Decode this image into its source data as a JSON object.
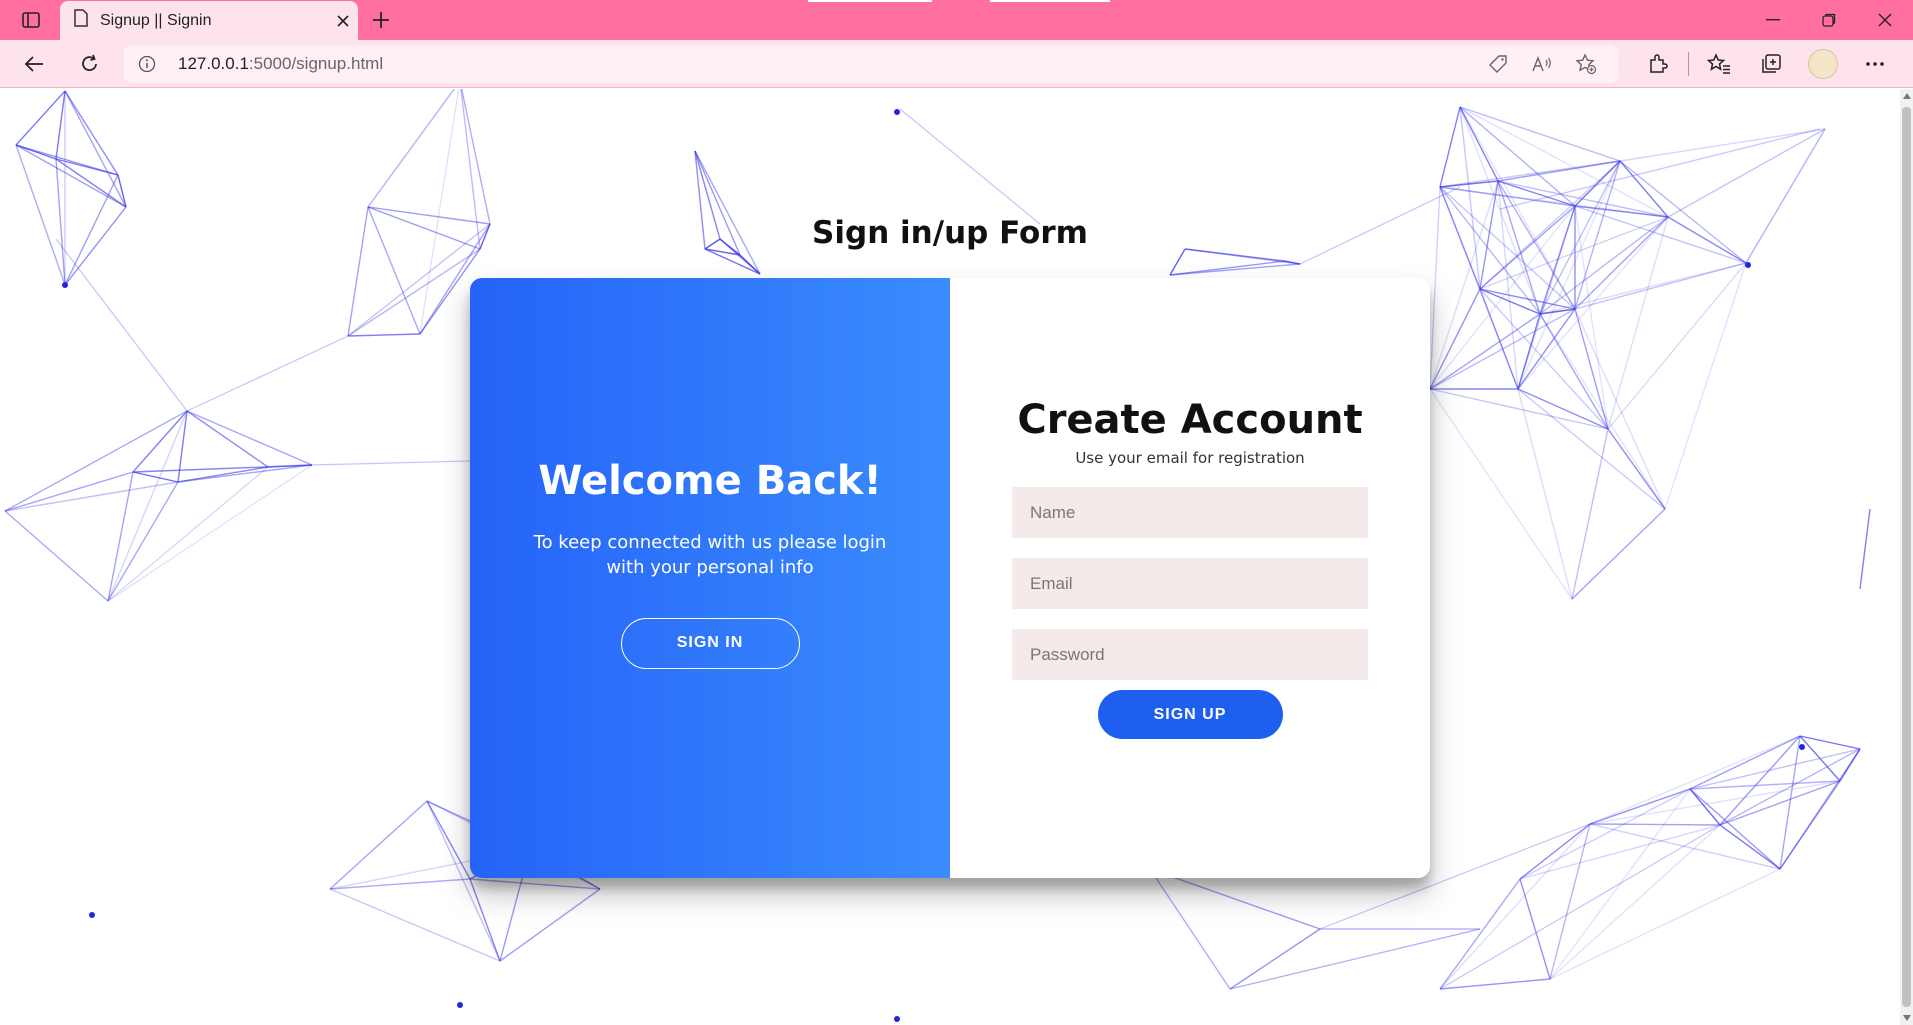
{
  "browser": {
    "tab_title": "Signup || Signin",
    "url_host": "127.0.0.1",
    "url_path": ":5000/signup.html",
    "accent": "#ff709e"
  },
  "page": {
    "heading": "Sign in/up Form"
  },
  "overlay": {
    "title": "Welcome Back!",
    "text": "To keep connected with us please login with your personal info",
    "button": "SIGN IN",
    "gradient_start": "#2563f8",
    "gradient_end": "#3a8cfd"
  },
  "signup_form": {
    "title": "Create Account",
    "subtitle": "Use your email for registration",
    "name_placeholder": "Name",
    "email_placeholder": "Email",
    "password_placeholder": "Password",
    "button": "SIGN UP"
  },
  "icons": [
    "sidebar-icon",
    "page-icon",
    "close-icon",
    "plus-icon",
    "minimize-icon",
    "restore-icon",
    "window-close-icon",
    "back-icon",
    "refresh-icon",
    "info-icon",
    "tag-icon",
    "read-aloud-icon",
    "favorite-add-icon",
    "extensions-icon",
    "favorites-icon",
    "collections-icon",
    "more-icon"
  ]
}
